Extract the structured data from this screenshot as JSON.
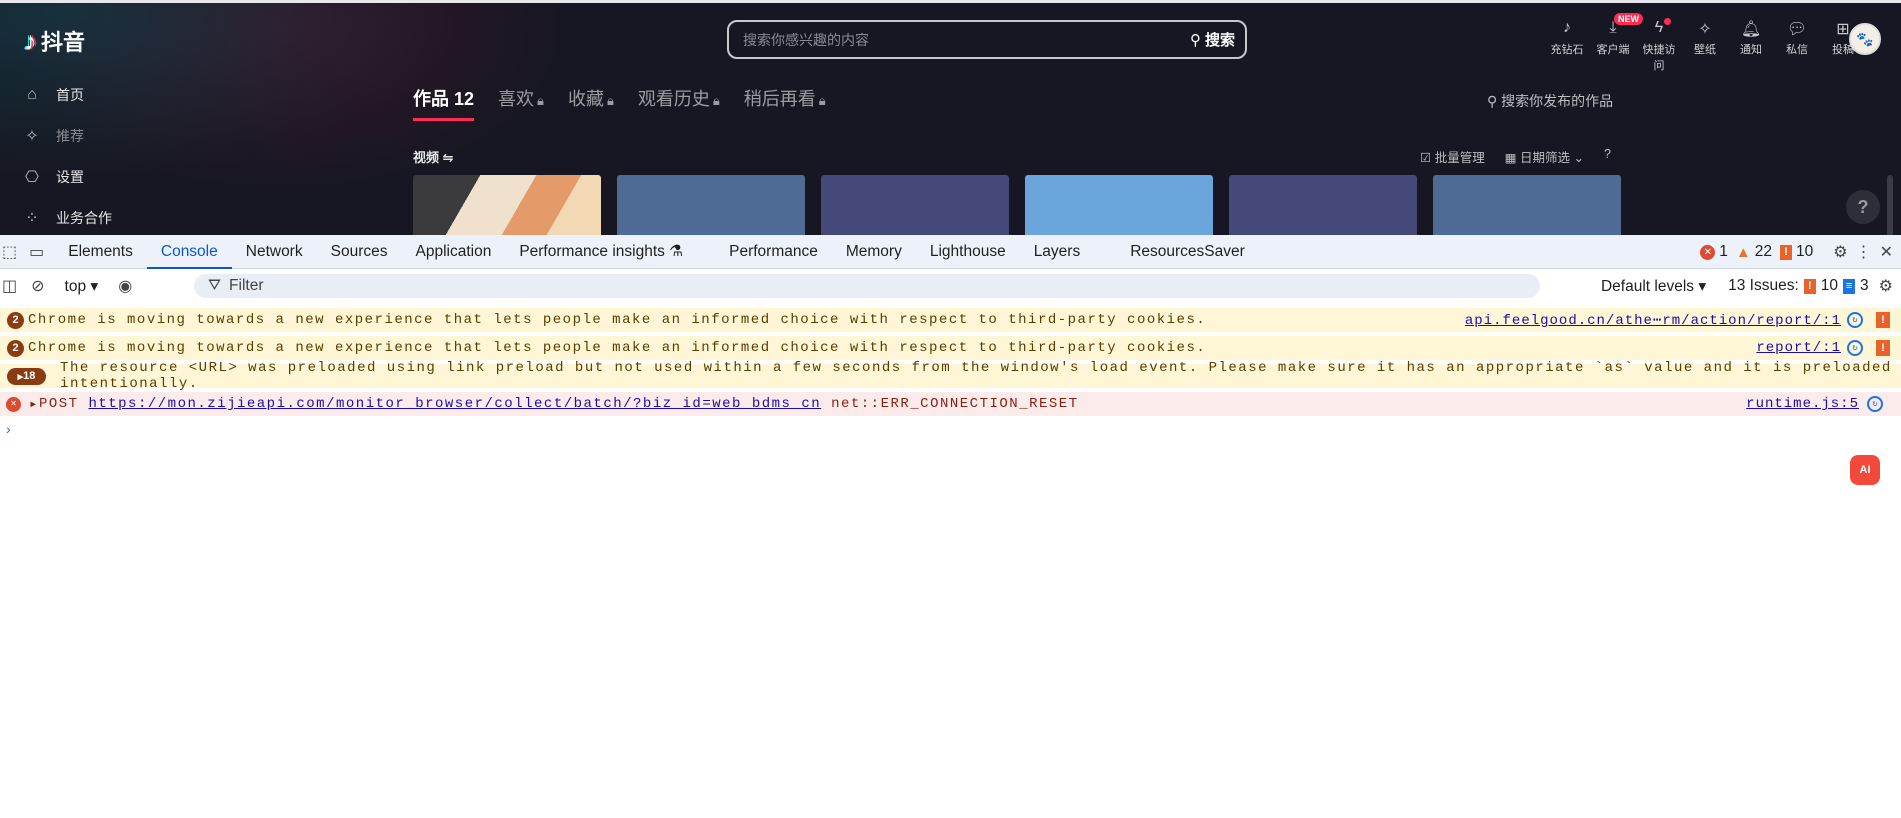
{
  "site": {
    "logo": "抖音",
    "search_placeholder": "搜索你感兴趣的内容",
    "search_button": "搜索",
    "top_icons": [
      {
        "label": "充钻石",
        "icon": "diamond-icon"
      },
      {
        "label": "客户端",
        "icon": "download-icon",
        "badge": "NEW"
      },
      {
        "label": "快捷访问",
        "icon": "lightning-icon"
      },
      {
        "label": "壁纸",
        "icon": "wallpaper-icon"
      },
      {
        "label": "通知",
        "icon": "bell-icon"
      },
      {
        "label": "私信",
        "icon": "message-icon"
      },
      {
        "label": "投稿",
        "icon": "upload-icon"
      }
    ],
    "sidebar": [
      {
        "label": "首页"
      },
      {
        "label": "推荐"
      },
      {
        "label": "设置"
      },
      {
        "label": "业务合作"
      }
    ],
    "tabs": [
      {
        "label": "作品 12"
      },
      {
        "label": "喜欢"
      },
      {
        "label": "收藏"
      },
      {
        "label": "观看历史"
      },
      {
        "label": "稍后再看"
      }
    ],
    "search_works": "搜索你发布的作品",
    "videos_label": "视频",
    "batch_manage": "批量管理",
    "date_filter": "日期筛选",
    "help": "?"
  },
  "devtools": {
    "tabs": [
      "Elements",
      "Console",
      "Network",
      "Sources",
      "Application",
      "Performance insights",
      "Performance",
      "Memory",
      "Lighthouse",
      "Layers",
      "ResourcesSaver"
    ],
    "active_tab": "Console",
    "counts": {
      "errors": "1",
      "warnings": "22",
      "issues": "10"
    },
    "context": "top",
    "filter_placeholder": "Filter",
    "levels": "Default levels",
    "issues_label": "13 Issues:",
    "issues_red": "10",
    "issues_blue": "3",
    "messages": [
      {
        "type": "warning",
        "repeat": "2",
        "text": "Chrome is moving towards a new experience that lets people make an informed choice with respect to third-party cookies.",
        "source": "api.feelgood.cn/athe⋯rm/action/report/:1"
      },
      {
        "type": "warning",
        "repeat": "2",
        "text": "Chrome is moving towards a new experience that lets people make an informed choice with respect to third-party cookies.",
        "source": "report/:1"
      },
      {
        "type": "warning",
        "repeat": "18",
        "text": "The resource <URL> was preloaded using link preload but not used within a few seconds from the window's load event. Please make sure it has an appropriate `as` value and it is preloaded intentionally."
      },
      {
        "type": "error",
        "method": "POST",
        "url": "https://mon.zijieapi.com/monitor_browser/collect/batch/?biz_id=web_bdms_cn",
        "error": "net::ERR_CONNECTION_RESET",
        "source": "runtime.js:5"
      }
    ],
    "ai_button": "AI"
  }
}
